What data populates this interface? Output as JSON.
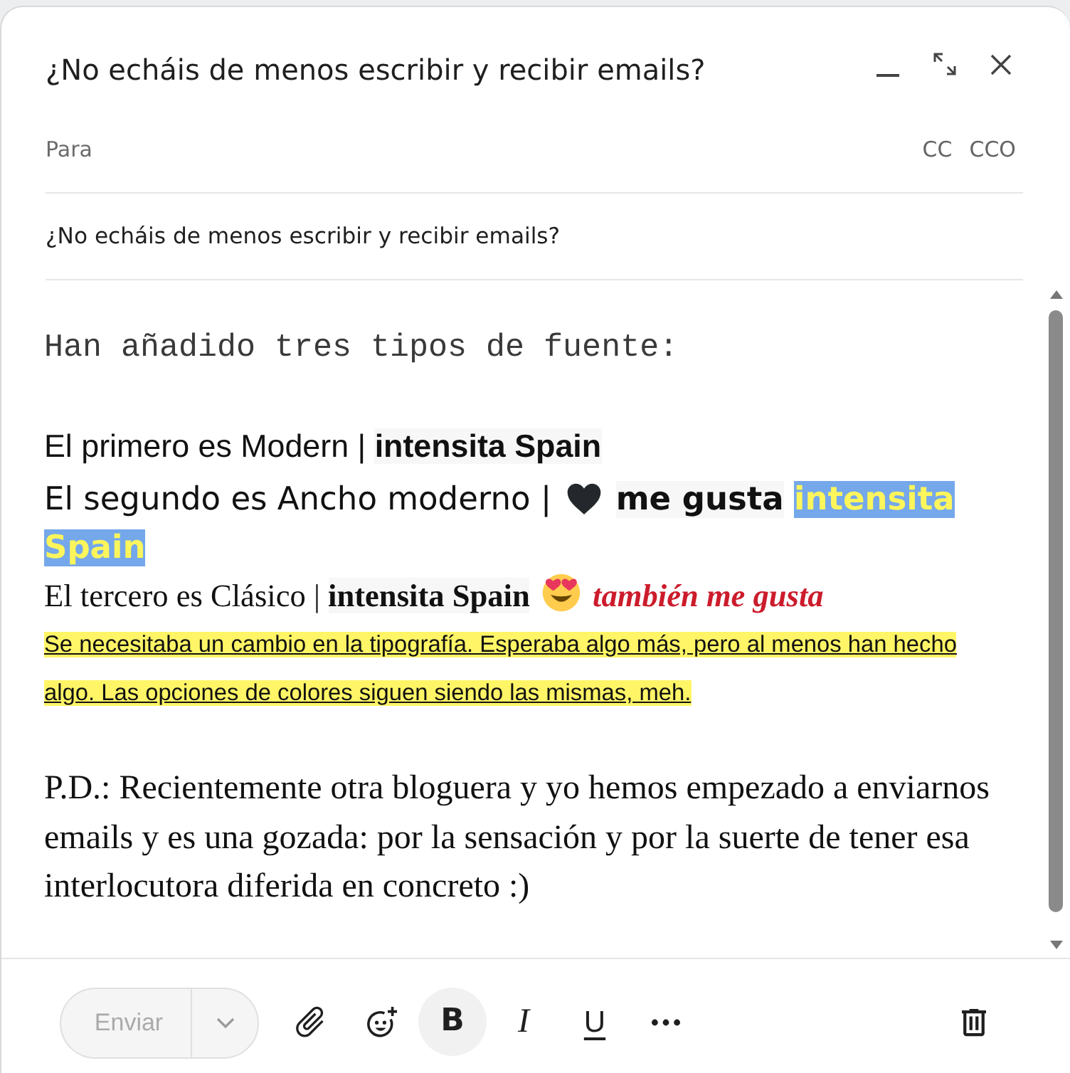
{
  "window": {
    "title": "¿No echáis de menos escribir y recibir emails?"
  },
  "recipients": {
    "placeholder": "Para",
    "extras": [
      "CC",
      "CCO"
    ]
  },
  "subject": {
    "value": "¿No echáis de menos escribir y recibir emails?"
  },
  "body": [
    {
      "kind": "mono",
      "text": "Han añadido tres tipos de fuente:"
    },
    {
      "kind": "modern",
      "runs": [
        {
          "kind": "text",
          "text": "El primero es Modern |"
        },
        {
          "kind": "bold",
          "text": "intensita Spain"
        }
      ]
    },
    {
      "kind": "wide",
      "runs": [
        {
          "kind": "text",
          "text": "El segundo es Ancho moderno |"
        },
        {
          "kind": "heart"
        },
        {
          "kind": "bold",
          "text": "me gusta"
        },
        {
          "kind": "highlight",
          "text": "intensita"
        },
        {
          "kind": "highlight",
          "text": "Spain"
        }
      ]
    },
    {
      "kind": "classic",
      "runs": [
        {
          "kind": "text",
          "text": "El tercero es Clásico |"
        },
        {
          "kind": "bold",
          "text": "intensita Spain"
        },
        {
          "kind": "heart_eyes"
        },
        {
          "kind": "emphasis",
          "text": "también me gusta"
        }
      ]
    },
    {
      "kind": "note",
      "text": "Se necesitaba un cambio en la tipografía. Esperaba algo más, pero al menos han hecho algo. Las opciones de colores siguen siendo las mismas, meh."
    },
    {
      "kind": "serif",
      "text": "P.D.: Recientemente otra bloguera y yo hemos empezado a enviarnos emails y es una gozada: por la sensación y por la suerte de tener esa interlocutora diferida en concreto :)"
    }
  ],
  "toolbar": {
    "send": {
      "label": "Enviar",
      "disabled": true
    },
    "format_buttons": [
      {
        "kind": "bold",
        "label": "B",
        "selected": true
      },
      {
        "kind": "italic",
        "label": "I",
        "selected": false
      },
      {
        "kind": "underline",
        "label": "U",
        "selected": false
      }
    ]
  }
}
